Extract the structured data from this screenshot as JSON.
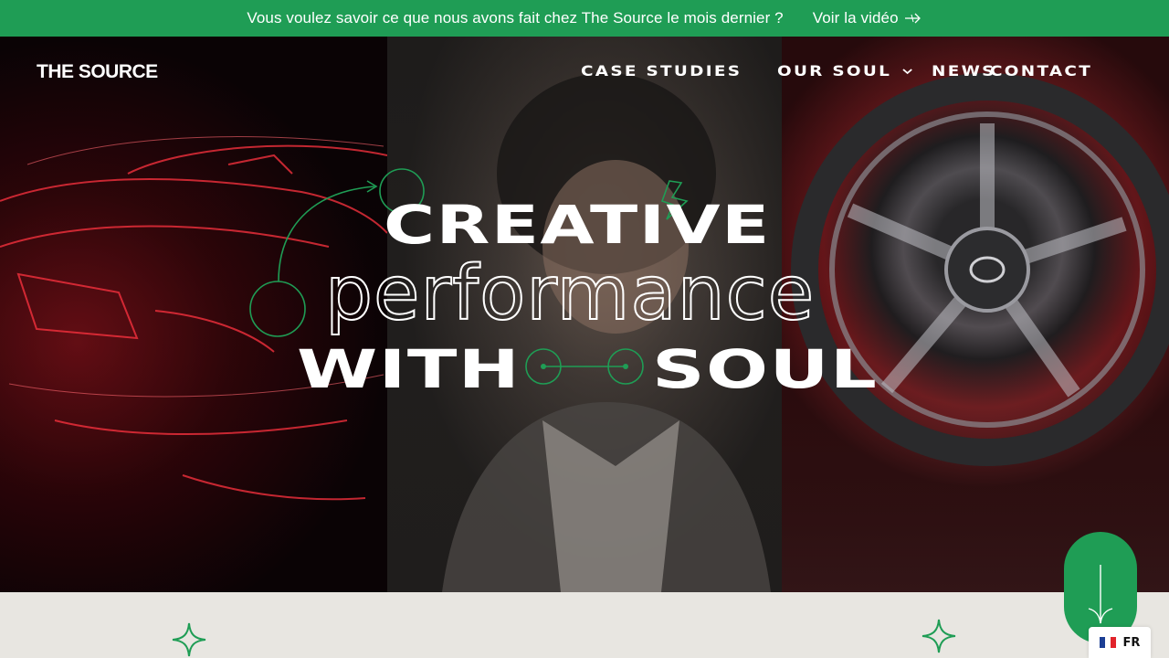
{
  "announcement": {
    "text": "Vous voulez savoir ce que nous avons fait chez The Source le mois dernier ?",
    "cta_label": "Voir la vidéo",
    "cta_icon": "arrow-right-icon",
    "background": "#1f9d55"
  },
  "header": {
    "logo_text": "THE SOURCE",
    "nav": [
      {
        "label": "CASE STUDIES"
      },
      {
        "label": "OUR SOUL",
        "icon": "chevron-down-icon"
      },
      {
        "label": "NEWS"
      },
      {
        "label": "CONTACT"
      }
    ]
  },
  "hero": {
    "line1": "CREATIVE",
    "line2": "performance",
    "line3_left": "WITH",
    "line3_right": "SOUL",
    "accent_color": "#1f9d55"
  },
  "scroll_button": {
    "icon": "arrow-down-icon"
  },
  "language": {
    "code": "FR",
    "flag_icon": "france-flag-icon"
  },
  "bottom_section": {
    "icons": [
      "sparkle-icon",
      "sparkle-icon"
    ],
    "background": "#e8e6e1"
  }
}
